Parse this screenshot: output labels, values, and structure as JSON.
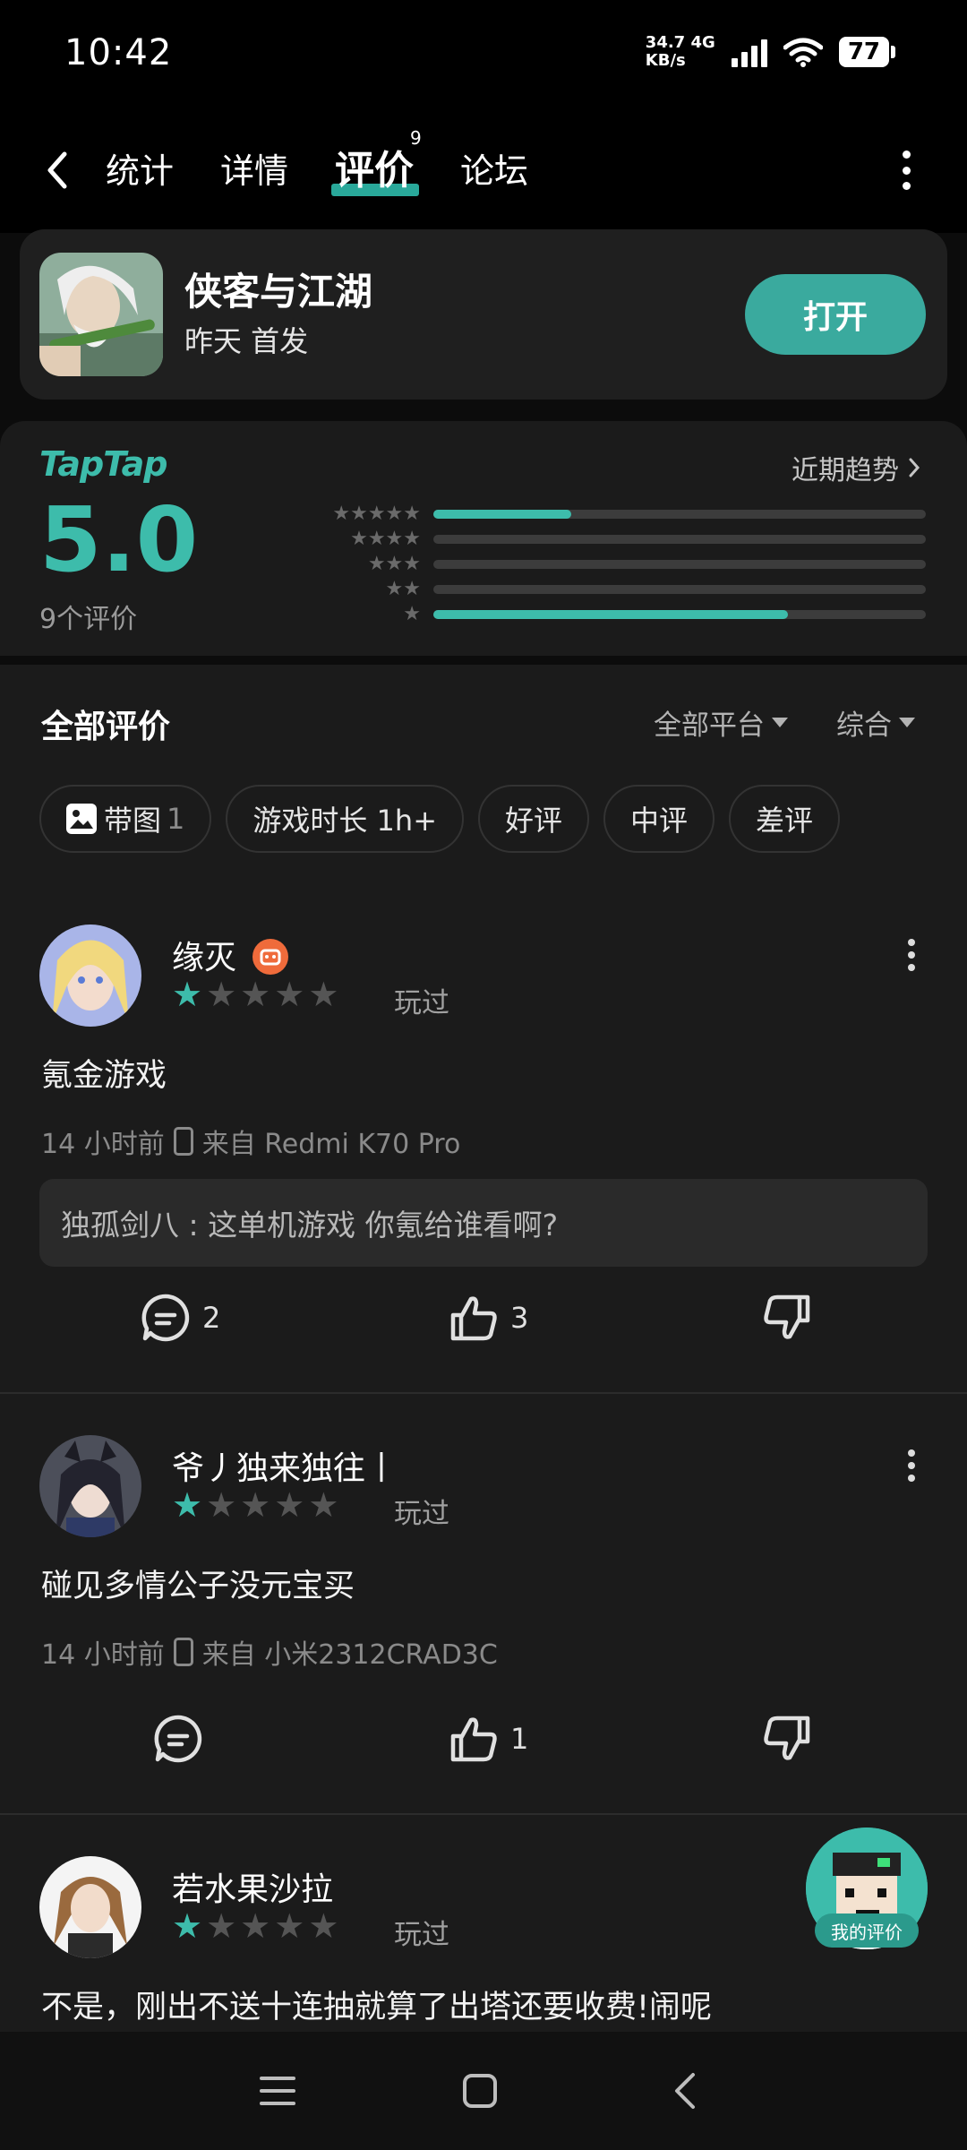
{
  "status_bar": {
    "time": "10:42",
    "net_speed": "34.7",
    "net_unit": "KB/s",
    "net_type": "4G",
    "battery": "77"
  },
  "nav": {
    "tabs": [
      {
        "label": "统计"
      },
      {
        "label": "详情"
      },
      {
        "label": "评价",
        "active": true,
        "badge": "9"
      },
      {
        "label": "论坛"
      }
    ]
  },
  "game": {
    "name": "侠客与江湖",
    "subtitle": "昨天 首发",
    "open_label": "打开"
  },
  "rating": {
    "brand": "TapTap",
    "score": "5.0",
    "count_label": "9个评价",
    "trend_label": "近期趋势",
    "distribution": [
      {
        "stars": 5,
        "fraction": 0.28
      },
      {
        "stars": 4,
        "fraction": 0.0
      },
      {
        "stars": 3,
        "fraction": 0.0
      },
      {
        "stars": 2,
        "fraction": 0.0
      },
      {
        "stars": 1,
        "fraction": 0.72
      }
    ]
  },
  "reviews_header": {
    "title": "全部评价",
    "platform_label": "全部平台",
    "sort_label": "综合"
  },
  "chips": [
    {
      "label": "带图",
      "count": "1",
      "icon": "image-icon"
    },
    {
      "label": "游戏时长 1h+"
    },
    {
      "label": "好评"
    },
    {
      "label": "中评"
    },
    {
      "label": "差评"
    }
  ],
  "reviews": [
    {
      "user": "缘灭",
      "stars": 1,
      "status": "玩过",
      "text": "氪金游戏",
      "time": "14 小时前",
      "device": "来自 Redmi  K70 Pro",
      "reply": "独孤剑八 : 这单机游戏 你氪给谁看啊?",
      "comments": "2",
      "likes": "3"
    },
    {
      "user": "爷丿独来独往丨",
      "stars": 1,
      "status": "玩过",
      "text": "碰见多情公子没元宝买",
      "time": "14 小时前",
      "device": "来自 小米2312CRAD3C",
      "comments": "",
      "likes": "1"
    },
    {
      "user": "若水果沙拉",
      "stars": 1,
      "status": "玩过",
      "text": "不是，刚出不送十连抽就算了出塔还要收费!闹呢"
    }
  ],
  "fab": {
    "label": "我的评价"
  },
  "colors": {
    "accent": "#3dbcab",
    "background": "#1b1b1b",
    "card": "#1f1f1f"
  }
}
